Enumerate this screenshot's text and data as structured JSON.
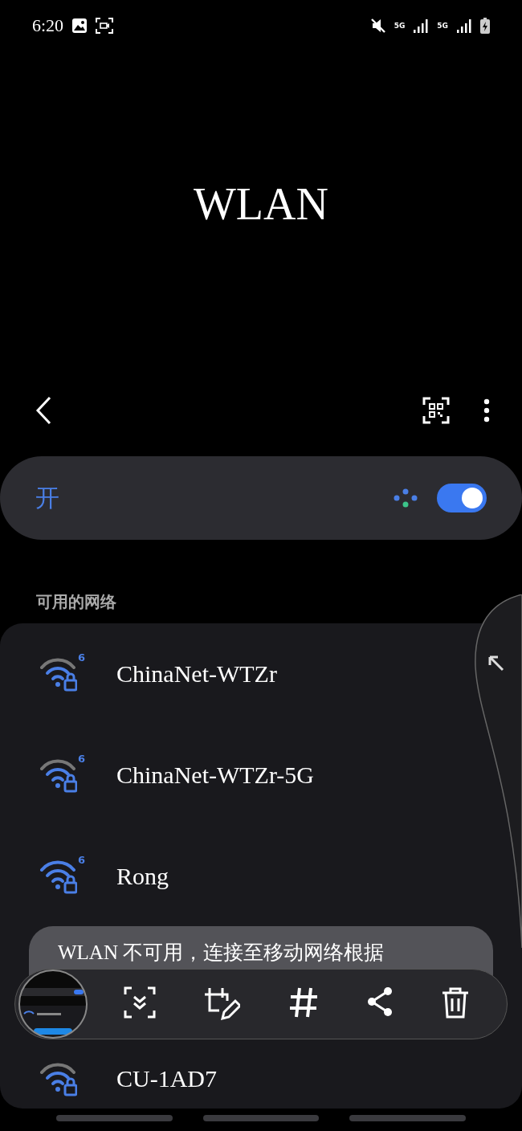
{
  "status_bar": {
    "time": "6:20",
    "network_labels": [
      "5G",
      "5G"
    ]
  },
  "header": {
    "title": "WLAN"
  },
  "master_switch": {
    "label": "开",
    "on": true
  },
  "section_title": "可用的网络",
  "networks": [
    {
      "name": "ChinaNet-WTZr",
      "kind": "medium",
      "badge": "6",
      "locked": true
    },
    {
      "name": "ChinaNet-WTZr-5G",
      "kind": "medium",
      "badge": "6",
      "locked": true
    },
    {
      "name": "Rong",
      "kind": "strong",
      "badge": "6",
      "locked": true
    },
    {
      "name": "CU-1AD7",
      "kind": "medium",
      "locked": true
    }
  ],
  "toast": {
    "text": "WLAN 不可用，连接至移动网络根据"
  }
}
